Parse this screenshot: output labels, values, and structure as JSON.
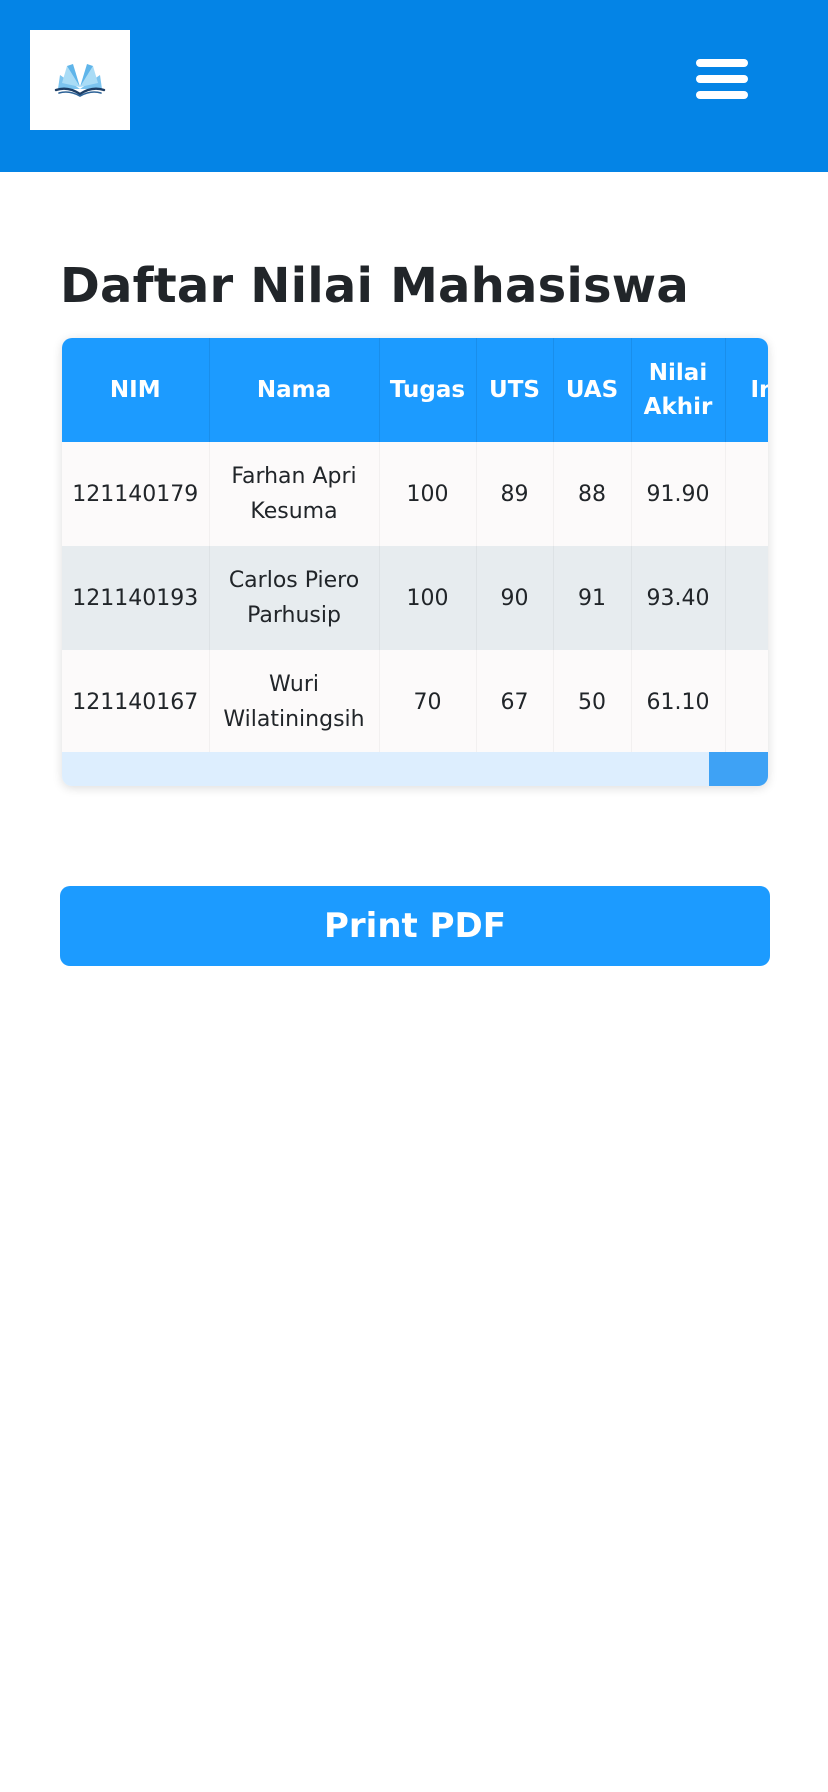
{
  "header": {
    "logo": {
      "icon": "open-book-icon"
    },
    "menu": {
      "icon": "hamburger-menu-icon"
    }
  },
  "page": {
    "title": "Daftar Nilai Mahasiswa"
  },
  "table": {
    "columns": [
      "NIM",
      "Nama",
      "Tugas",
      "UTS",
      "UAS",
      "Nilai Akhir",
      "Indeks"
    ],
    "rows": [
      [
        "121140179",
        "Farhan Apri Kesuma",
        "100",
        "89",
        "88",
        "91.90"
      ],
      [
        "121140193",
        "Carlos Piero Parhusip",
        "100",
        "90",
        "91",
        "93.40"
      ],
      [
        "121140167",
        "Wuri Wilatiningsih",
        "70",
        "67",
        "50",
        "61.10"
      ]
    ]
  },
  "actions": {
    "print_label": "Print PDF"
  },
  "colors": {
    "header_bg": "#0484e6",
    "accent": "#1c9bff",
    "row_alt": "#e7ecef",
    "scroll_track": "#ddeefe",
    "scroll_thumb": "#3ea2f5"
  }
}
